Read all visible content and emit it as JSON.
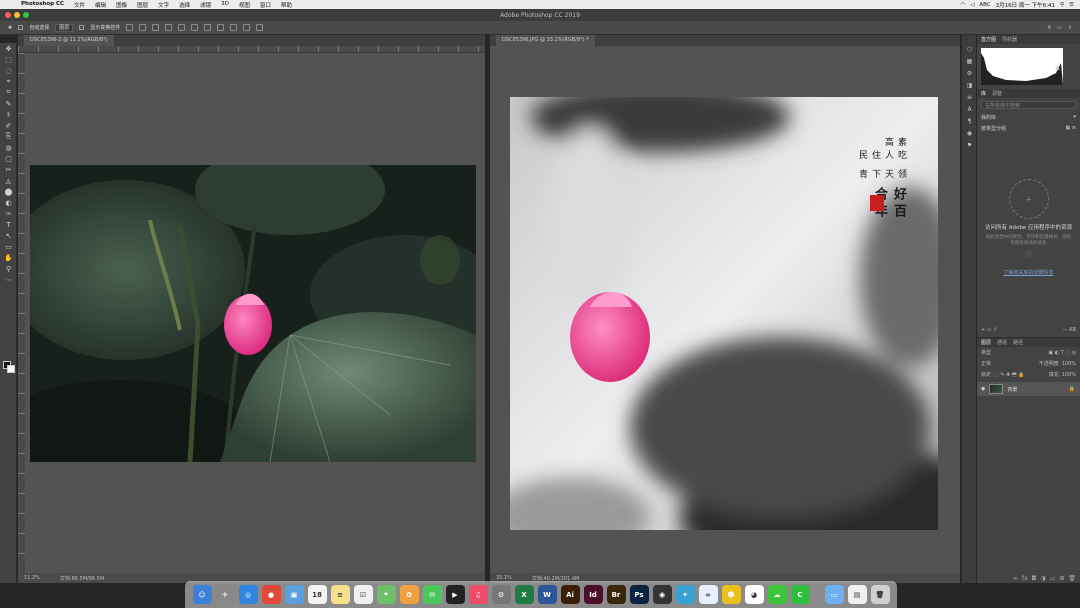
{
  "menubar": {
    "apple": "",
    "items": [
      "Photoshop CC",
      "文件",
      "编辑",
      "图像",
      "图层",
      "文字",
      "选择",
      "滤镜",
      "3D",
      "视图",
      "窗口",
      "帮助"
    ],
    "status": {
      "input_label": "ABC",
      "clock": "3月16日 周一 下午6:41"
    }
  },
  "window": {
    "title": "Adobe Photoshop CC 2019",
    "traffic": [
      "#ff5f57",
      "#febc2e",
      "#28c840"
    ]
  },
  "options": {
    "auto_select": "自动选择",
    "target": "图层",
    "show_transform": "显示变换控件"
  },
  "tools": [
    "✥",
    "⬚",
    "◌",
    "⌖",
    "⌗",
    "✎",
    "⚕",
    "✐",
    "⎘",
    "◍",
    "▢",
    "✂",
    "◬",
    "⬤",
    "◐",
    "✑",
    "T",
    "↖",
    "▭",
    "✋",
    "⚲",
    "⋯"
  ],
  "doc1": {
    "tab": "DSC05396-2 @ 11.2%(RGB/8*)",
    "zoom": "11.2%",
    "info": "文档:86.5M/86.5M"
  },
  "doc2": {
    "tab": "DSC05396.JPG @ 33.1%(RGB/8*) *",
    "zoom": "33.1%",
    "info": "文档:40.2M/201.4M"
  },
  "calligraphy": [
    "百年",
    "好合",
    "领天下青",
    "吃人住民",
    "素高"
  ],
  "right_dock_icons": [
    "⬡",
    "▦",
    "⚙",
    "◨",
    "≡",
    "A",
    "¶",
    "◉",
    "⚑"
  ],
  "histogram": {
    "tab_active": "直方图",
    "tab_other": "导航器"
  },
  "libraries": {
    "tabs": [
      "库",
      "调整"
    ],
    "search_placeholder": "在所有库中搜索",
    "lib_name": "我的库",
    "view_label": "按类型分组",
    "empty_title": "访问所有 Adobe 应用程序中的资源",
    "empty_sub": "将此文档中的颜色、字符和段落样式、图形和图层拖动到此处",
    "link": "了解有关库的详细信息",
    "size": "— KB"
  },
  "layers": {
    "tabs": [
      "图层",
      "通道",
      "路径"
    ],
    "kind": "类型",
    "blend": "正常",
    "opacity_label": "不透明度",
    "opacity": "100%",
    "lock_label": "锁定",
    "fill_label": "填充",
    "fill": "100%",
    "layer_name": "背景"
  },
  "dock_apps": [
    {
      "n": "finder-icon",
      "t": "☺",
      "c": "#3b7fd8"
    },
    {
      "n": "launchpad-icon",
      "t": "✈",
      "c": "#888"
    },
    {
      "n": "safari-icon",
      "t": "◎",
      "c": "#2f86e0"
    },
    {
      "n": "chrome-icon",
      "t": "●",
      "c": "#e0483a"
    },
    {
      "n": "preview-icon",
      "t": "▣",
      "c": "#5aa0e0"
    },
    {
      "n": "calendar-icon",
      "t": "18",
      "c": "#f3f3f3"
    },
    {
      "n": "notes-icon",
      "t": "≡",
      "c": "#f7e08a"
    },
    {
      "n": "reminders-icon",
      "t": "☑",
      "c": "#f0f0f0"
    },
    {
      "n": "maps-icon",
      "t": "⌖",
      "c": "#6fbf6a"
    },
    {
      "n": "photos-icon",
      "t": "✿",
      "c": "#f0a040"
    },
    {
      "n": "messages-icon",
      "t": "✉",
      "c": "#4ac95a"
    },
    {
      "n": "quicktime-icon",
      "t": "▶",
      "c": "#222"
    },
    {
      "n": "music-icon",
      "t": "♫",
      "c": "#f04c6a"
    },
    {
      "n": "system-prefs-icon",
      "t": "⚙",
      "c": "#777"
    },
    {
      "n": "excel-icon",
      "t": "X",
      "c": "#1f7a44"
    },
    {
      "n": "word-icon",
      "t": "W",
      "c": "#2b5797"
    },
    {
      "n": "illustrator-icon",
      "t": "Ai",
      "c": "#3a1f05"
    },
    {
      "n": "indesign-icon",
      "t": "Id",
      "c": "#4b0f2b"
    },
    {
      "n": "bridge-icon",
      "t": "Br",
      "c": "#3a2608"
    },
    {
      "n": "photoshop-icon",
      "t": "Ps",
      "c": "#0a2340"
    },
    {
      "n": "davinci-icon",
      "t": "◉",
      "c": "#333"
    },
    {
      "n": "wechat-work-icon",
      "t": "✦",
      "c": "#3aa0d0"
    },
    {
      "n": "baidu-netdisk-icon",
      "t": "∞",
      "c": "#e8f0ff"
    },
    {
      "n": "taobao-icon",
      "t": "☻",
      "c": "#e8c020"
    },
    {
      "n": "qq-icon",
      "t": "◕",
      "c": "#fff"
    },
    {
      "n": "wechat-icon",
      "t": "☁",
      "c": "#3ec43a"
    },
    {
      "n": "iqiyi-icon",
      "t": "C",
      "c": "#2fbf3c"
    },
    {
      "n": "folder-icon",
      "t": "▭",
      "c": "#6fb0f0"
    },
    {
      "n": "document-icon",
      "t": "▤",
      "c": "#f0f0f0"
    },
    {
      "n": "trash-icon",
      "t": "🗑",
      "c": "#d0d0d0"
    }
  ]
}
